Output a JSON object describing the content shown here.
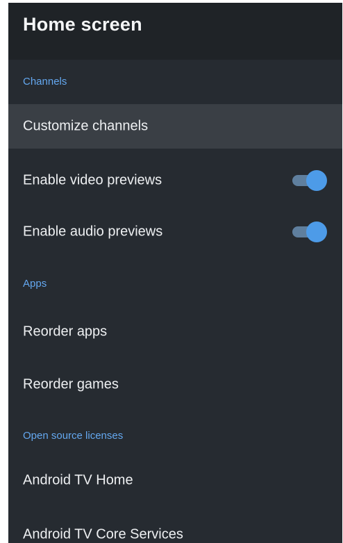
{
  "header": {
    "title": "Home screen"
  },
  "sections": {
    "channels": "Channels",
    "apps": "Apps",
    "licenses": "Open source licenses"
  },
  "items": {
    "customize_channels": "Customize channels",
    "video_previews": "Enable video previews",
    "audio_previews": "Enable audio previews",
    "reorder_apps": "Reorder apps",
    "reorder_games": "Reorder games",
    "android_tv_home": "Android TV Home",
    "android_tv_core": "Android TV Core Services"
  },
  "toggles": {
    "video_previews_on": true,
    "audio_previews_on": true
  },
  "colors": {
    "background": "#262b31",
    "header": "#1f2327",
    "focused_row": "#3a3f45",
    "section_accent": "#64a8f0",
    "toggle_on": "#4d9be8"
  }
}
